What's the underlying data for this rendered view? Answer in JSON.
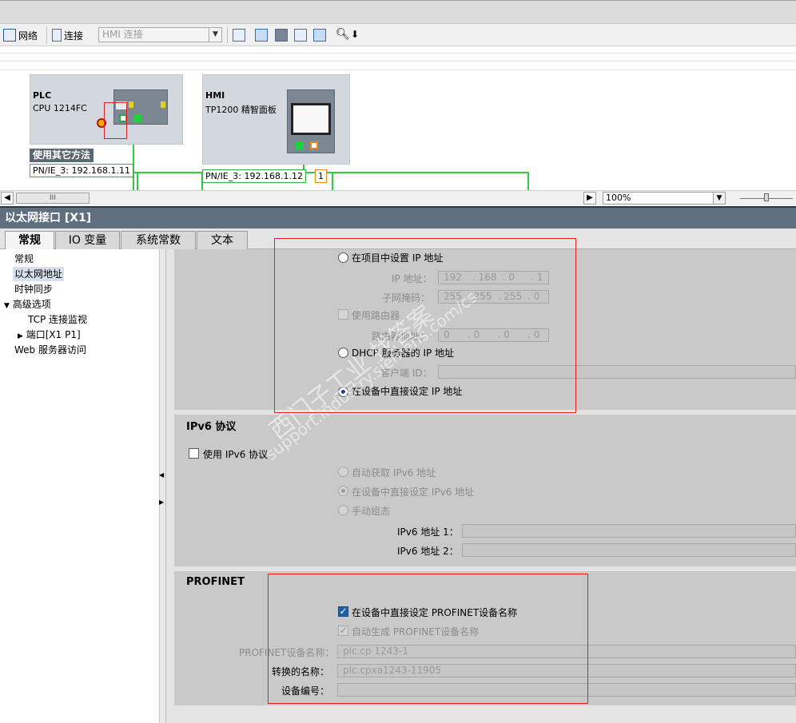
{
  "toolbar": {
    "network_label": "网络",
    "connect_label": "连接",
    "hmi_conn_value": "HMI 连接"
  },
  "canvas": {
    "plc": {
      "title": "PLC",
      "model": "CPU 1214FC",
      "method_label": "使用其它方法",
      "ip_tag": "PN/IE_3:  192.168.1.11"
    },
    "hmi": {
      "title": "HMI",
      "model": "TP1200 精智面板",
      "ip_tag": "PN/IE_3:  192.168.1.12",
      "port_tag": "1"
    }
  },
  "scroll": {
    "zoom_value": "100%",
    "thumb": "III"
  },
  "inspector": {
    "title": "以太网接口 [X1]",
    "tabs": [
      "常规",
      "IO 变量",
      "系统常数",
      "文本"
    ]
  },
  "nav": {
    "items": [
      "常规",
      "以太网地址",
      "时钟同步",
      "高级选项",
      "TCP 连接监视",
      "端口[X1 P1]",
      "Web 服务器访问"
    ]
  },
  "ipv4": {
    "opt_project": "在项目中设置 IP 地址",
    "ip_label": "IP 地址：",
    "ip_value": [
      "192",
      "168",
      "0",
      "1"
    ],
    "mask_label": "子网掩码：",
    "mask_value": [
      "255",
      "255",
      "255",
      "0"
    ],
    "router_check": "使用路由器",
    "router_label": "路由器地址：",
    "router_value": [
      "0",
      "0",
      "0",
      "0"
    ],
    "opt_dhcp": "DHCP 服务器的 IP 地址",
    "client_label": "客户端 ID：",
    "opt_direct": "在设备中直接设定 IP 地址"
  },
  "ipv6": {
    "title": "IPv6 协议",
    "use_check": "使用 IPv6 协议",
    "opt_auto": "自动获取 IPv6 地址",
    "opt_direct": "在设备中直接设定 IPv6 地址",
    "opt_manual": "手动组态",
    "addr1_label": "IPv6 地址 1：",
    "addr2_label": "IPv6 地址 2："
  },
  "profinet": {
    "title": "PROFINET",
    "direct_check": "在设备中直接设定 PROFINET设备名称",
    "auto_check": "自动生成 PROFINET设备名称",
    "name_label": "PROFINET设备名称：",
    "name_value": "plc.cp 1243-1",
    "conv_label": "转换的名称：",
    "conv_value": "plc.cpxa1243-11905",
    "devnum_label": "设备编号："
  },
  "watermark": {
    "cn": "西门子工业 找答案",
    "url": "support.industry.siemens.com/cs"
  },
  "colors": {
    "net_green": "#2ecc40",
    "annot_red": "#e02020",
    "title_bar": "#5f6f7f",
    "check_blue": "#1f5fa8"
  }
}
